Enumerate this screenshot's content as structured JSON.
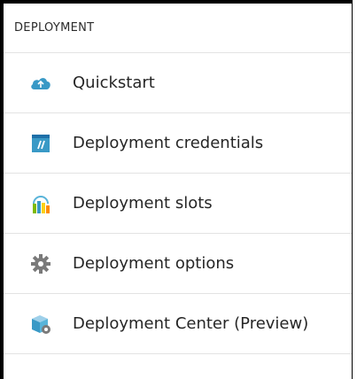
{
  "section": {
    "title": "DEPLOYMENT"
  },
  "items": [
    {
      "label": "Quickstart",
      "icon": "cloud-upload-icon"
    },
    {
      "label": "Deployment credentials",
      "icon": "credentials-icon"
    },
    {
      "label": "Deployment slots",
      "icon": "slots-icon"
    },
    {
      "label": "Deployment options",
      "icon": "gear-icon"
    },
    {
      "label": "Deployment Center (Preview)",
      "icon": "deployment-center-icon"
    }
  ],
  "colors": {
    "azure_blue": "#3999c6",
    "light_blue": "#59b4d9",
    "gray_icon": "#7a7a7a",
    "divider": "#e3e3e3"
  }
}
